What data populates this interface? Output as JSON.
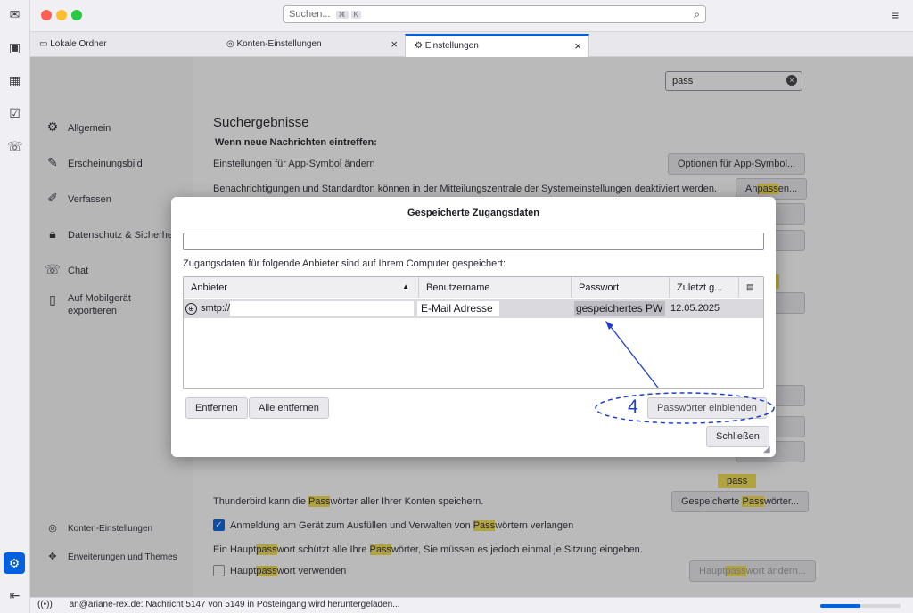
{
  "search": {
    "placeholder": "Suchen...",
    "kbd1": "⌘",
    "kbd2": "K"
  },
  "tabs": [
    {
      "label": "Lokale Ordner"
    },
    {
      "label": "Konten-Einstellungen"
    },
    {
      "label": "Einstellungen"
    }
  ],
  "settings_search": {
    "value": "pass"
  },
  "nav": [
    {
      "label": "Allgemein",
      "icon": "gear-icon"
    },
    {
      "label": "Erscheinungsbild",
      "icon": "brush-icon"
    },
    {
      "label": "Verfassen",
      "icon": "pencil-icon"
    },
    {
      "label": "Datenschutz & Sicherheit",
      "icon": "lock-icon"
    },
    {
      "label": "Chat",
      "icon": "chat-icon"
    },
    {
      "label": "Auf Mobilgerät exportieren",
      "icon": "mobile-icon"
    }
  ],
  "nav_bottom": [
    {
      "label": "Konten-Einstellungen"
    },
    {
      "label": "Erweiterungen und Themes"
    }
  ],
  "main": {
    "heading": "Suchergebnisse",
    "subheading": "Wenn neue Nachrichten eintreffen:",
    "row1": "Einstellungen für App-Symbol ändern",
    "row1_btn": "Optionen für App-Symbol...",
    "row2": "Benachrichtigungen und Standardton können in der Mitteilungszentrale der Systemeinstellungen deaktiviert werden.",
    "row2_btn_a": "An",
    "row2_btn_hl": "pass",
    "row2_btn_b": "en...",
    "tooltip": "pass",
    "pw_text_a": "Thunderbird kann die ",
    "pw_text_hl": "Pass",
    "pw_text_b": "wörter aller Ihrer Konten speichern.",
    "pw_btn_a": "Gespeicherte ",
    "pw_btn_hl": "Pass",
    "pw_btn_b": "wörter...",
    "chk1_a": "Anmeldung am Gerät zum Ausfüllen und Verwalten von ",
    "chk1_hl": "Pass",
    "chk1_b": "wörtern verlangen",
    "master_a": "Ein Haupt",
    "master_hl1": "pass",
    "master_b": "wort schützt alle Ihre ",
    "master_hl2": "Pass",
    "master_c": "wörter, Sie müssen es jedoch einmal je Sitzung eingeben.",
    "chk2_a": "Haupt",
    "chk2_hl": "pass",
    "chk2_b": "wort verwenden",
    "master_btn_a": "Haupt",
    "master_btn_hl": "pass",
    "master_btn_b": "wort ändern..."
  },
  "dialog": {
    "title": "Gespeicherte Zugangsdaten",
    "filter_value": "",
    "description": "Zugangsdaten für folgende Anbieter sind auf Ihrem Computer gespeichert:",
    "columns": {
      "provider": "Anbieter",
      "username": "Benutzername",
      "password": "Passwort",
      "last_changed": "Zuletzt g..."
    },
    "row": {
      "provider": "smtp://",
      "username": "E-Mail Adresse",
      "password": "gespeichertes PW",
      "date": "12.05.2025"
    },
    "annotation_number": "4",
    "remove": "Entfernen",
    "remove_all": "Alle entfernen",
    "show_passwords": "Passwörter einblenden",
    "close": "Schließen"
  },
  "status": {
    "text": "an@ariane-rex.de: Nachricht 5147 von 5149 in Posteingang wird heruntergeladen...",
    "progress": 0.5
  },
  "colors": {
    "accent": "#0060df",
    "highlight": "#f5de4a",
    "annotation": "#1f3fd1"
  }
}
